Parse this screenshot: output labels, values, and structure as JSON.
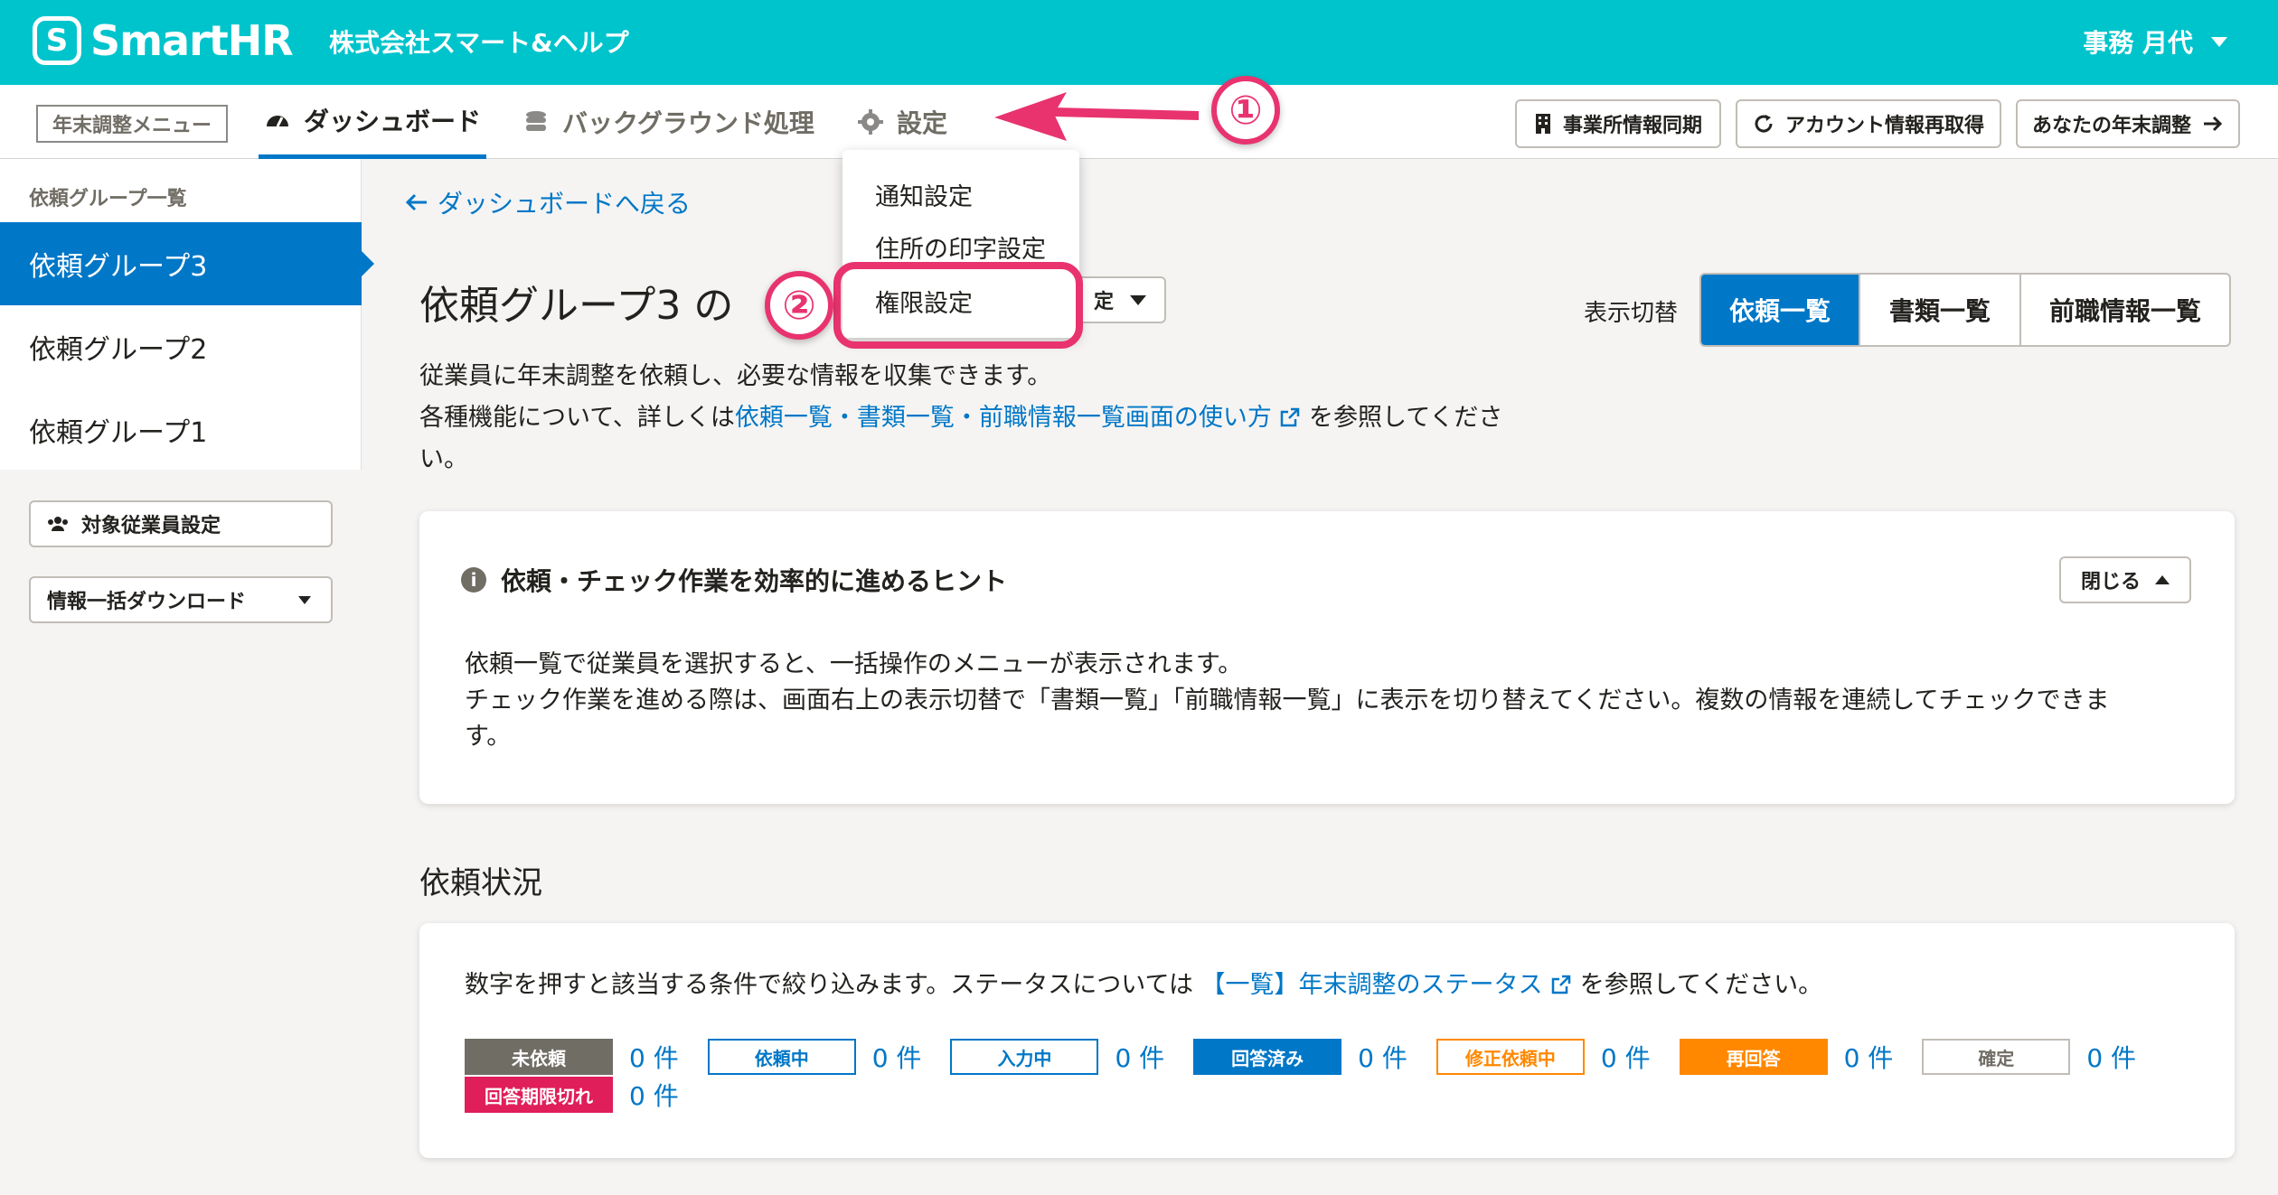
{
  "header": {
    "logo_mark": "S",
    "logo_text": "SmartHR",
    "company": "株式会社スマート&ヘルプ",
    "user_name": "事務 月代"
  },
  "subnav": {
    "menu_badge": "年末調整メニュー",
    "tabs": [
      {
        "label": "ダッシュボード",
        "icon": "dashboard-icon"
      },
      {
        "label": "バックグラウンド処理",
        "icon": "database-icon"
      },
      {
        "label": "設定",
        "icon": "gear-icon"
      }
    ],
    "right_buttons": [
      {
        "label": "事業所情報同期",
        "icon": "building-icon"
      },
      {
        "label": "アカウント情報再取得",
        "icon": "refresh-icon"
      },
      {
        "label": "あなたの年末調整",
        "icon": "arrow-right-icon"
      }
    ]
  },
  "dropdown": {
    "items": [
      "通知設定",
      "住所の印字設定",
      "権限設定"
    ]
  },
  "sidebar": {
    "heading": "依頼グループ一覧",
    "groups": [
      "依頼グループ3",
      "依頼グループ2",
      "依頼グループ1"
    ],
    "buttons": [
      "対象従業員設定",
      "情報一括ダウンロード"
    ]
  },
  "main": {
    "back_link": "ダッシュボードへ戻る",
    "title": "依頼グループ3 の",
    "title_select_label": "定",
    "desc_line1": "従業員に年末調整を依頼し、必要な情報を収集できます。",
    "desc_line2_pre": "各種機能について、詳しくは",
    "desc_link": "依頼一覧・書類一覧・前職情報一覧画面の使い方",
    "desc_line2_post": "を参照してくださ",
    "desc_line3": "い。",
    "view_label": "表示切替",
    "view_tabs": [
      "依頼一覧",
      "書類一覧",
      "前職情報一覧"
    ]
  },
  "hint": {
    "title": "依頼・チェック作業を効率的に進めるヒント",
    "close_label": "閉じる",
    "body_line1": "依頼一覧で従業員を選択すると、一括操作のメニューが表示されます。",
    "body_line2": "チェック作業を進める際は、画面右上の表示切替で「書類一覧」「前職情報一覧」に表示を切り替えてください。複数の情報を連続してチェックできま",
    "body_line3": "す。"
  },
  "status": {
    "section_title": "依頼状況",
    "text_pre": "数字を押すと該当する条件で絞り込みます。ステータスについては",
    "text_link": "【一覧】年末調整のステータス",
    "text_post": "を参照してください。",
    "items": [
      {
        "label": "未依頼",
        "count": "0 件"
      },
      {
        "label": "依頼中",
        "count": "0 件"
      },
      {
        "label": "入力中",
        "count": "0 件"
      },
      {
        "label": "回答済み",
        "count": "0 件"
      },
      {
        "label": "修正依頼中",
        "count": "0 件"
      },
      {
        "label": "再回答",
        "count": "0 件"
      },
      {
        "label": "確定",
        "count": "0 件"
      },
      {
        "label": "回答期限切れ",
        "count": "0 件"
      }
    ]
  },
  "annotations": {
    "marker1": "①",
    "marker2": "②"
  },
  "colors": {
    "brand": "#00c4cc",
    "primary": "#0077c7",
    "annotation": "#e8336f"
  }
}
